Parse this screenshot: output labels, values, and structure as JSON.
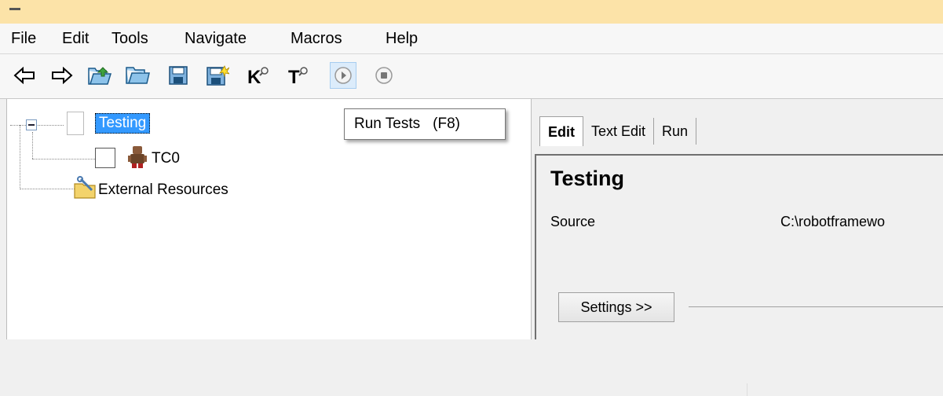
{
  "menu": [
    "File",
    "Edit",
    "Tools",
    "Navigate",
    "Macros",
    "Help"
  ],
  "toolbar": {
    "items": [
      "back-arrow-icon",
      "forward-arrow-icon",
      "open-folder-icon",
      "folder-icon",
      "save-icon",
      "save-all-icon",
      "search-keywords-icon",
      "search-tests-icon",
      "run-tests-icon",
      "stop-icon"
    ]
  },
  "tooltip": {
    "label": "Run Tests",
    "shortcut": "(F8)"
  },
  "tree": {
    "suite": "Testing",
    "testcase": "TC0",
    "resources": "External Resources"
  },
  "tabs": [
    "Edit",
    "Text Edit",
    "Run"
  ],
  "editor": {
    "title": "Testing",
    "source_label": "Source",
    "source_value": "C:\\robotframewo",
    "settings_button": "Settings >>"
  },
  "colors": {
    "titlebar": "#fce3a8",
    "selection": "#3399ff",
    "tooltip_bg": "#ffffff"
  }
}
